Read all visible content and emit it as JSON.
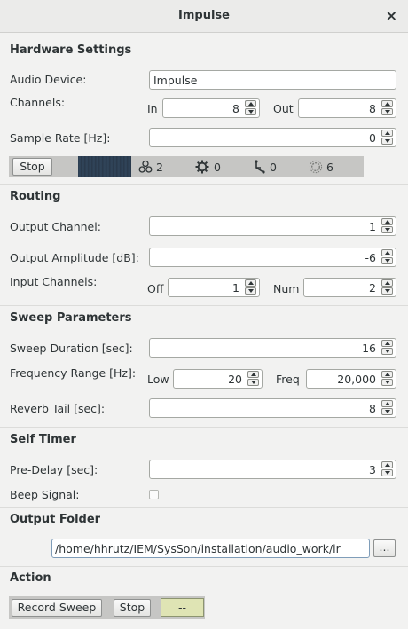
{
  "window": {
    "title": "Impulse",
    "close_glyph": "×"
  },
  "hardware": {
    "heading": "Hardware Settings",
    "audio_device_label": "Audio Device:",
    "audio_device_value": "Impulse",
    "channels_label": "Channels:",
    "in_label": "In",
    "in_value": "8",
    "out_label": "Out",
    "out_value": "8",
    "sample_rate_label": "Sample Rate [Hz]:",
    "sample_rate_value": "0",
    "stop_label": "Stop",
    "status": {
      "synths": "2",
      "ugens": "0",
      "groups": "0",
      "defs": "6"
    }
  },
  "routing": {
    "heading": "Routing",
    "output_channel_label": "Output Channel:",
    "output_channel_value": "1",
    "output_amplitude_label": "Output Amplitude [dB]:",
    "output_amplitude_value": "-6",
    "input_channels_label": "Input Channels:",
    "off_label": "Off",
    "off_value": "1",
    "num_label": "Num",
    "num_value": "2"
  },
  "sweep": {
    "heading": "Sweep Parameters",
    "duration_label": "Sweep Duration [sec]:",
    "duration_value": "16",
    "freq_range_label": "Frequency Range [Hz]:",
    "low_label": "Low",
    "low_value": "20",
    "freq_label": "Freq",
    "freq_value": "20,000",
    "reverb_label": "Reverb Tail [sec]:",
    "reverb_value": "8"
  },
  "timer": {
    "heading": "Self Timer",
    "predelay_label": "Pre-Delay [sec]:",
    "predelay_value": "3",
    "beep_label": "Beep Signal:",
    "beep_checked": false
  },
  "output": {
    "heading": "Output Folder",
    "path": "/home/hhrutz/IEM/SysSon/installation/audio_work/ir",
    "browse_label": "..."
  },
  "action": {
    "heading": "Action",
    "record_label": "Record Sweep",
    "stop_label": "Stop",
    "indicator": "--"
  }
}
